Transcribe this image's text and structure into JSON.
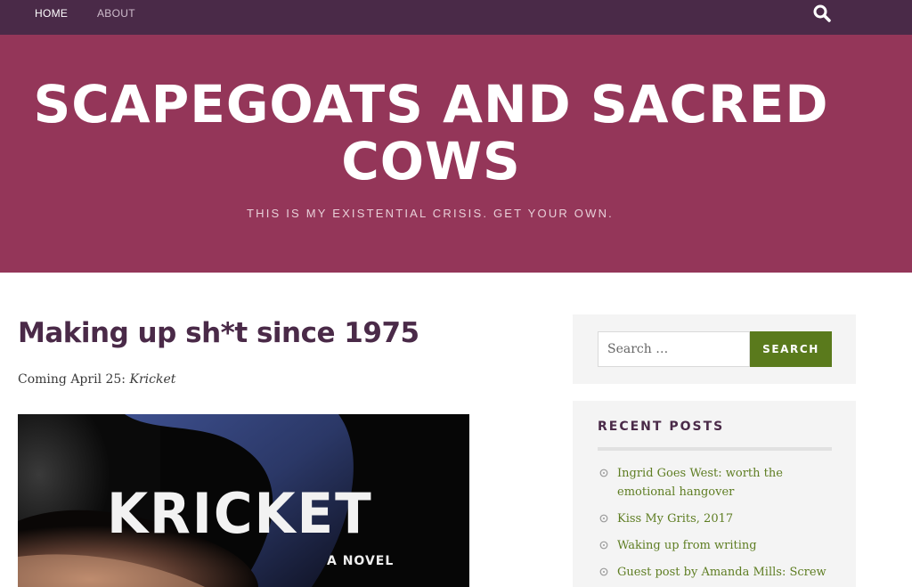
{
  "nav": {
    "items": [
      {
        "label": "HOME"
      },
      {
        "label": "ABOUT"
      }
    ],
    "search_icon": "search-icon"
  },
  "header": {
    "title_line1": "SCAPEGOATS AND SACRED",
    "title_line2": "COWS",
    "tagline": "THIS IS MY EXISTENTIAL CRISIS. GET YOUR OWN."
  },
  "post": {
    "title": "Making up sh*t since 1975",
    "coming_prefix": "Coming April 25: ",
    "coming_title": "Kricket",
    "cover": {
      "title": "KRICKET",
      "subtitle": "A NOVEL"
    }
  },
  "sidebar": {
    "search": {
      "placeholder": "Search …",
      "button_label": "SEARCH"
    },
    "recent": {
      "title": "RECENT POSTS",
      "items": [
        {
          "label": "Ingrid Goes West: worth the emotional hangover"
        },
        {
          "label": "Kiss My Grits, 2017"
        },
        {
          "label": "Waking up from writing"
        },
        {
          "label": "Guest post by Amanda Mills: Screw"
        }
      ]
    }
  },
  "colors": {
    "nav_bg": "#4a2a48",
    "hero_bg": "#943659",
    "accent_green": "#5a7a1c",
    "link_green": "#5e7d22",
    "heading_purple": "#4a2a48"
  }
}
